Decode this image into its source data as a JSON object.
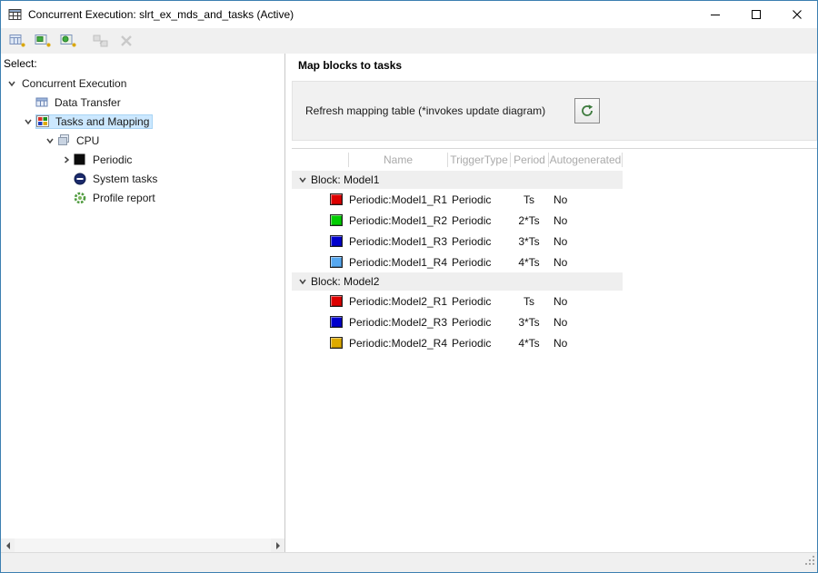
{
  "window": {
    "title": "Concurrent Execution: slrt_ex_mds_and_tasks (Active)"
  },
  "sidebar": {
    "label": "Select:",
    "tree": [
      {
        "label": "Concurrent Execution",
        "expanded": true
      },
      {
        "label": "Data Transfer"
      },
      {
        "label": "Tasks and Mapping",
        "expanded": true,
        "selected": true
      },
      {
        "label": "CPU",
        "expanded": true
      },
      {
        "label": "Periodic",
        "expanded": false
      },
      {
        "label": "System tasks"
      },
      {
        "label": "Profile report"
      }
    ],
    "selection_color": "#cce8ff"
  },
  "main": {
    "title": "Map blocks to tasks",
    "refresh_label": "Refresh mapping table (*invokes update diagram)",
    "table": {
      "columns": [
        "Name",
        "TriggerType",
        "Period",
        "Autogenerated"
      ],
      "groups": [
        {
          "label": "Block: Model1",
          "rows": [
            {
              "name": "Periodic:Model1_R1",
              "color": "#dd0000",
              "trigger": "Periodic",
              "period": "Ts",
              "autogenerated": "No"
            },
            {
              "name": "Periodic:Model1_R2",
              "color": "#00cc00",
              "trigger": "Periodic",
              "period": "2*Ts",
              "autogenerated": "No"
            },
            {
              "name": "Periodic:Model1_R3",
              "color": "#0000cc",
              "trigger": "Periodic",
              "period": "3*Ts",
              "autogenerated": "No"
            },
            {
              "name": "Periodic:Model1_R4",
              "color": "#56a8f0",
              "trigger": "Periodic",
              "period": "4*Ts",
              "autogenerated": "No"
            }
          ]
        },
        {
          "label": "Block: Model2",
          "rows": [
            {
              "name": "Periodic:Model2_R1",
              "color": "#dd0000",
              "trigger": "Periodic",
              "period": "Ts",
              "autogenerated": "No"
            },
            {
              "name": "Periodic:Model2_R3",
              "color": "#0000cc",
              "trigger": "Periodic",
              "period": "3*Ts",
              "autogenerated": "No"
            },
            {
              "name": "Periodic:Model2_R4",
              "color": "#ddaa00",
              "trigger": "Periodic",
              "period": "4*Ts",
              "autogenerated": "No"
            }
          ]
        }
      ]
    }
  }
}
